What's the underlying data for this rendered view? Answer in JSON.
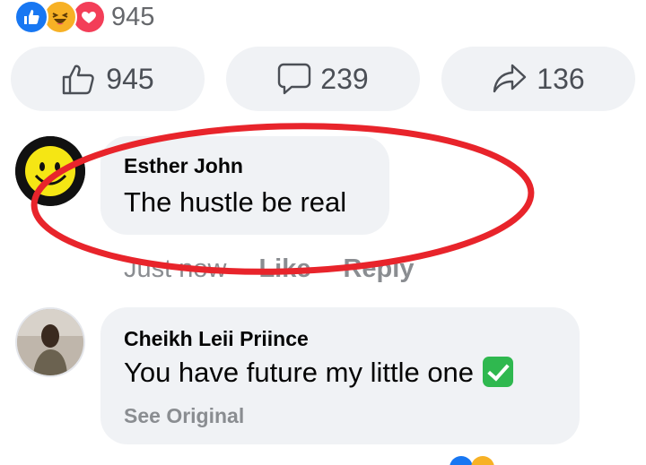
{
  "reactions": {
    "icons": [
      "thumbs-up-icon",
      "laughing-face-icon",
      "heart-icon"
    ],
    "count": "945"
  },
  "actions": {
    "like_count": "945",
    "comment_count": "239",
    "share_count": "136"
  },
  "comments": [
    {
      "author": "Esther John",
      "text": "The hustle be real",
      "time": "Just now",
      "like_label": "Like",
      "reply_label": "Reply"
    },
    {
      "author": "Cheikh Leii Priince",
      "text": "You have future my little one",
      "see_original": "See Original"
    }
  ],
  "colors": {
    "like_blue": "#1877f2",
    "haha_yellow": "#f7b125",
    "love_red": "#f33e58",
    "bubble_gray": "#f0f2f5",
    "annotation_red": "#e8242b",
    "check_green": "#2fb84f"
  }
}
